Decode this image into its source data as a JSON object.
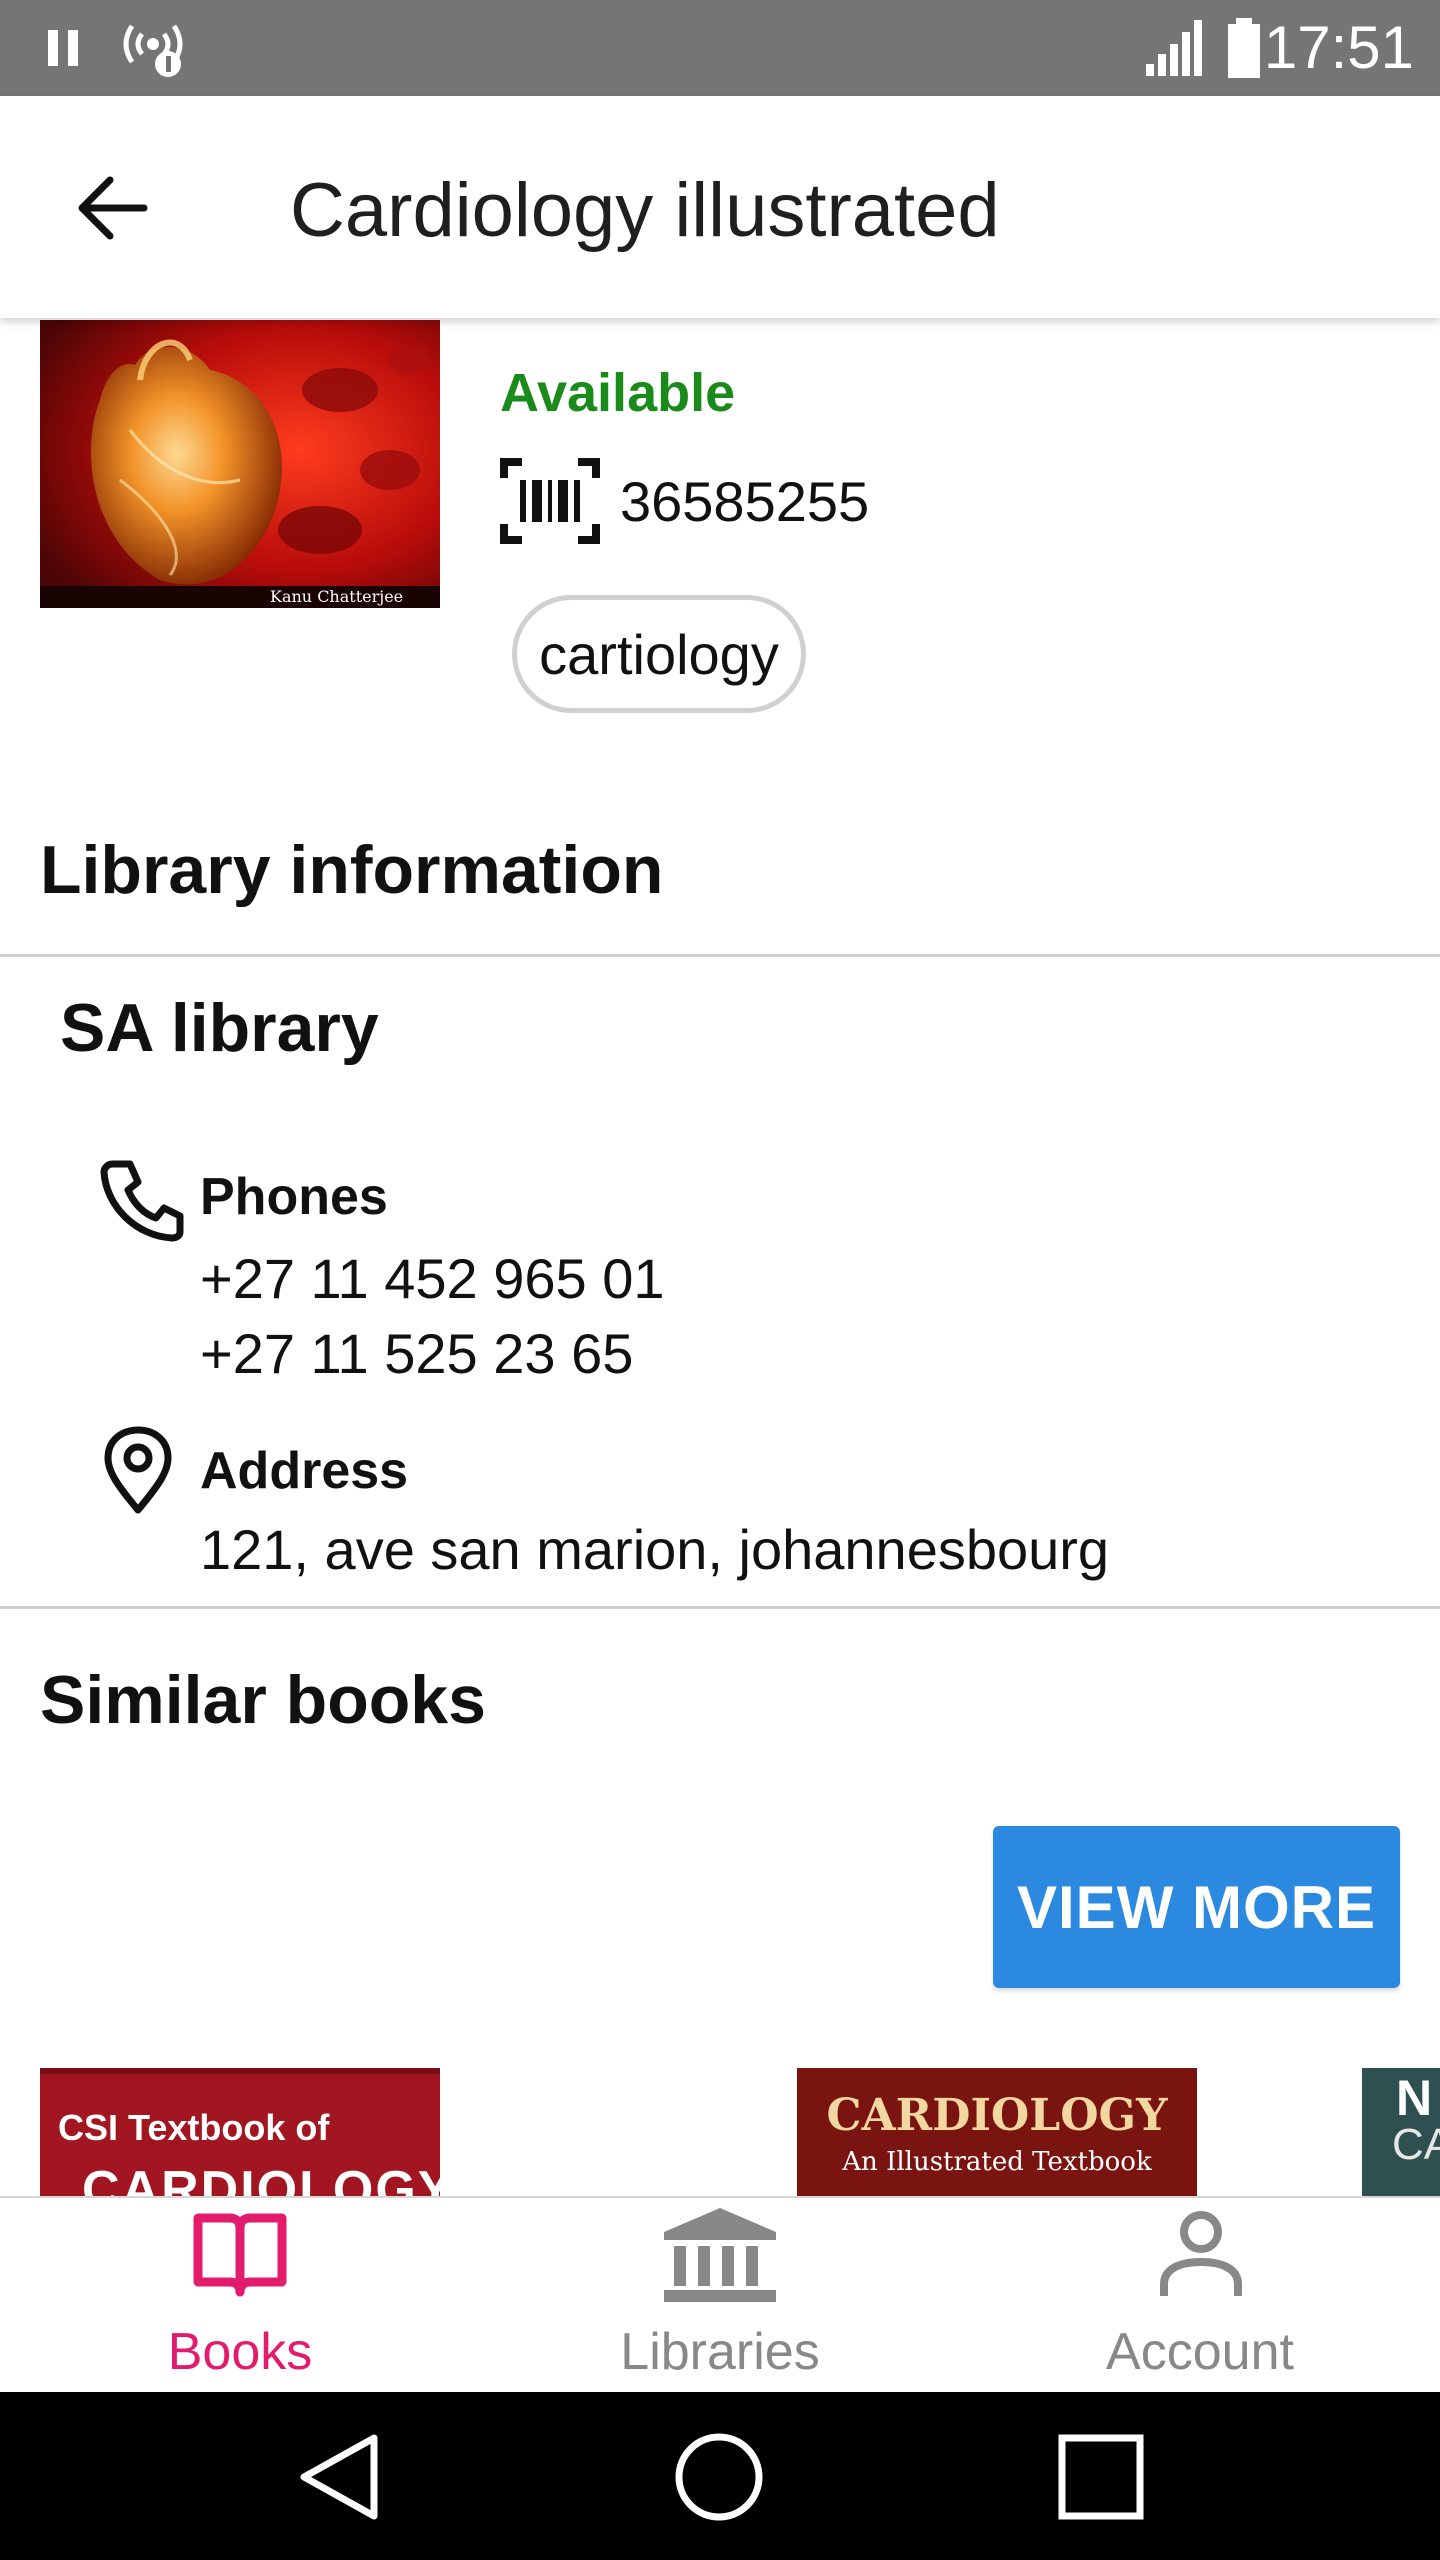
{
  "status_bar": {
    "time": "17:51"
  },
  "app_bar": {
    "title": "Cardiology illustrated"
  },
  "book": {
    "cover_author": "Kanu Chatterjee",
    "availability": "Available",
    "barcode": "36585255",
    "tag": "cartiology"
  },
  "library_info": {
    "heading": "Library information",
    "library_name": "SA library",
    "phones_label": "Phones",
    "phones": [
      "+27 11 452 965 01",
      "+27 11 525 23 65"
    ],
    "address_label": "Address",
    "address": "121, ave san marion,  johannesbourg"
  },
  "similar_books": {
    "heading": "Similar books",
    "view_more_label": "VIEW MORE",
    "items": [
      {
        "line1": "CSI Textbook of",
        "line2": "CARDIOLOGY"
      },
      {
        "line1": "CARDIOLOGY",
        "line2": "An Illustrated Textbook"
      },
      {
        "line1": "N",
        "line2": "CA"
      }
    ]
  },
  "bottom_nav": {
    "items": [
      {
        "label": "Books",
        "active": true
      },
      {
        "label": "Libraries",
        "active": false
      },
      {
        "label": "Account",
        "active": false
      }
    ],
    "active_color": "#e31b6d",
    "inactive_color": "#888888"
  },
  "colors": {
    "available": "#1a8a1a",
    "accent_button": "#2b8ae0"
  }
}
